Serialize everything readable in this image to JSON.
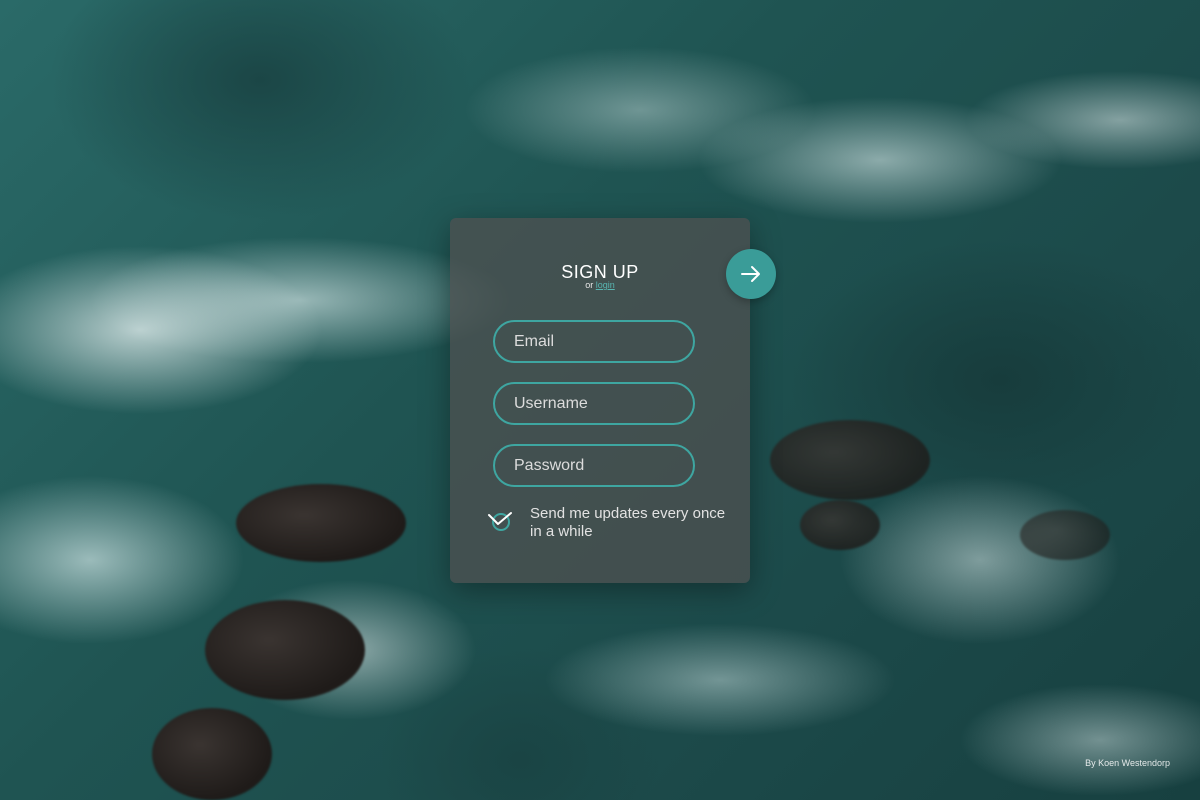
{
  "form": {
    "title": "SIGN UP",
    "subtitle_prefix": "or",
    "login_link": "login",
    "email_placeholder": "Email",
    "username_placeholder": "Username",
    "password_placeholder": "Password",
    "updates_label": "Send me updates every once in a while",
    "updates_checked": true,
    "submit_icon": "arrow-right-icon"
  },
  "footer": {
    "credit": "By Koen Westendorp"
  },
  "colors": {
    "accent": "#3ea6a1",
    "button": "#3a9c98",
    "card": "#505050"
  }
}
